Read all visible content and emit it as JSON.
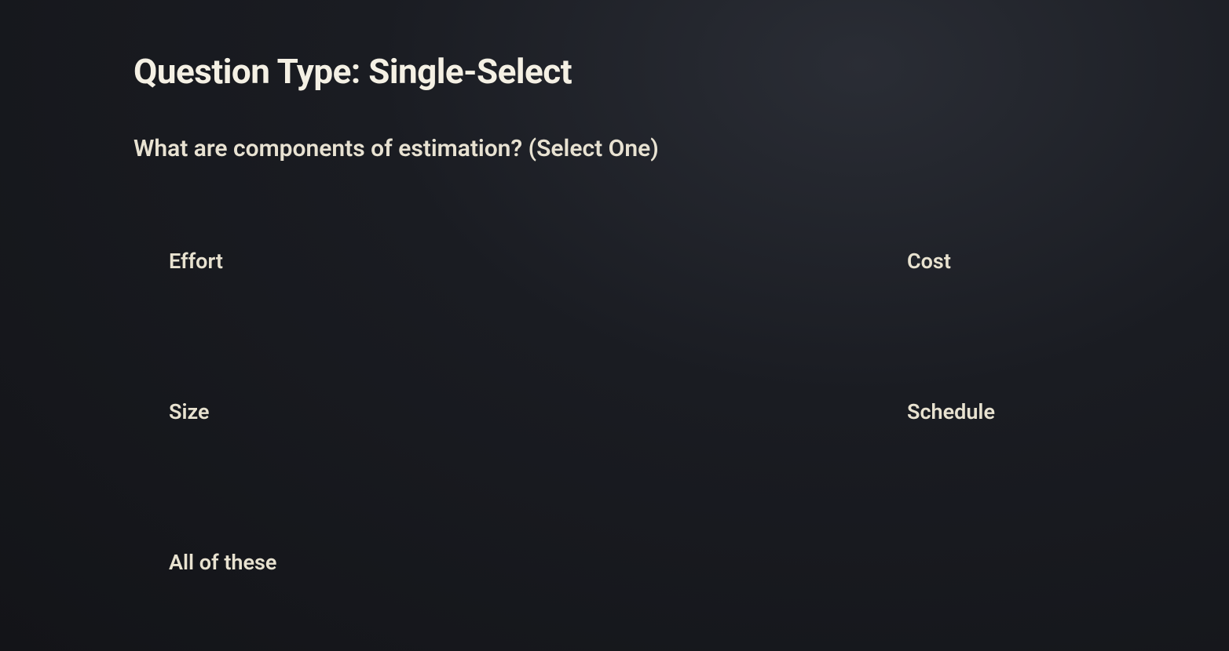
{
  "header": {
    "label_prefix": "Question Type: ",
    "type_value": "Single-Select"
  },
  "question": {
    "text": "What are components of estimation? (Select One)"
  },
  "options": [
    {
      "label": "Effort"
    },
    {
      "label": "Cost"
    },
    {
      "label": "Size"
    },
    {
      "label": "Schedule"
    },
    {
      "label": "All of these"
    }
  ]
}
